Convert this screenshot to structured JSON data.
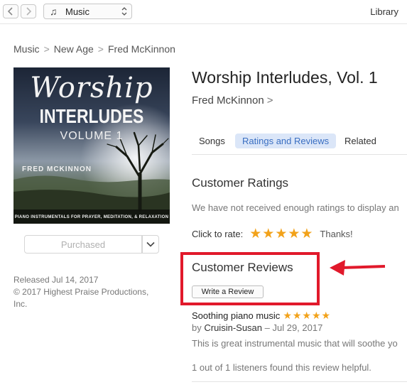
{
  "toolbar": {
    "back_icon": "chevron-left-icon",
    "forward_icon": "chevron-right-icon",
    "media_icon": "music-note-icon",
    "media_label": "Music",
    "library_label": "Library"
  },
  "breadcrumb": {
    "items": [
      "Music",
      "New Age",
      "Fred McKinnon"
    ],
    "separator": ">"
  },
  "artwork": {
    "script_title": "Worship",
    "main_title": "INTERLUDES",
    "volume": "VOLUME 1",
    "artist": "FRED MCKINNON",
    "tagline": "PIANO INSTRUMENTALS FOR PRAYER, MEDITATION, & RELAXATION"
  },
  "purchase": {
    "label": "Purchased",
    "menu_icon": "chevron-down-icon"
  },
  "release": {
    "date": "Released Jul 14, 2017",
    "copyright": "© 2017 Highest Praise Productions, Inc."
  },
  "album": {
    "title": "Worship Interludes, Vol. 1",
    "artist": "Fred McKinnon",
    "artist_chevron": ">"
  },
  "tabs": [
    {
      "label": "Songs",
      "active": false
    },
    {
      "label": "Ratings and Reviews",
      "active": true
    },
    {
      "label": "Related",
      "active": false
    }
  ],
  "ratings": {
    "heading": "Customer Ratings",
    "notice": "We have not received enough ratings to display an",
    "click_to_rate": "Click to rate:",
    "stars": "★★★★★",
    "user_rating": 5,
    "thanks": "Thanks!"
  },
  "reviews": {
    "heading": "Customer Reviews",
    "write_button": "Write a Review",
    "items": [
      {
        "title": "Soothing piano music",
        "stars": "★★★★★",
        "rating": 5,
        "by": "by",
        "author": "Cruisin-Susan",
        "date": "– Jul 29, 2017",
        "body": "This is great instrumental music that will soothe yo",
        "helpful": "1 out of 1 listeners found this review helpful."
      }
    ]
  },
  "annotation": {
    "box_color": "#e1192b",
    "arrow_color": "#e1192b"
  },
  "colors": {
    "accent": "#3a6fc2",
    "active_tab_bg": "#dbe6f8",
    "star": "#f2a21a"
  }
}
